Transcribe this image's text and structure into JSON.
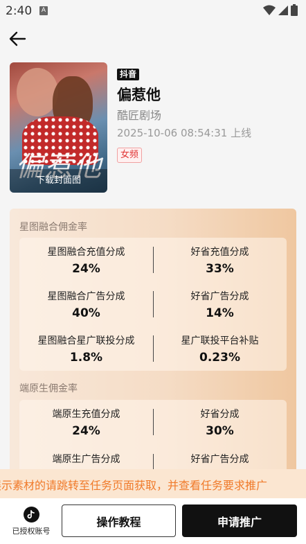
{
  "status_bar": {
    "time": "2:40",
    "notif_letter": "A"
  },
  "cover": {
    "download_label": "下载封面图",
    "art_title": "偏惹他"
  },
  "drama": {
    "platform": "抖音",
    "title": "偏惹他",
    "studio": "酷匠剧场",
    "online_time": "2025-10-06 08:54:31 上线",
    "tag": "女频"
  },
  "commission": {
    "xingtu": {
      "title": "星图融合佣金率",
      "items": [
        {
          "label": "星图融合充值分成",
          "value": "24%"
        },
        {
          "label": "好省充值分成",
          "value": "33%"
        },
        {
          "label": "星图融合广告分成",
          "value": "40%"
        },
        {
          "label": "好省广告分成",
          "value": "14%"
        },
        {
          "label": "星图融合星广联投分成",
          "value": "1.8%"
        },
        {
          "label": "星广联投平台补贴",
          "value": "0.23%"
        }
      ]
    },
    "native": {
      "title": "端原生佣金率",
      "items": [
        {
          "label": "端原生充值分成",
          "value": "24%"
        },
        {
          "label": "好省分成",
          "value": "30%"
        },
        {
          "label": "端原生广告分成",
          "value": ""
        },
        {
          "label": "好省广告分成",
          "value": ""
        }
      ]
    }
  },
  "marquee": "展示素材的请跳转至任务页面获取，并查看任务要求推广",
  "bottom_bar": {
    "auth_label": "已授权账号",
    "tutorial_label": "操作教程",
    "apply_label": "申请推广"
  },
  "colors": {
    "accent_orange": "#f07a2a",
    "tag_red": "#e03434",
    "primary_black": "#111111"
  }
}
